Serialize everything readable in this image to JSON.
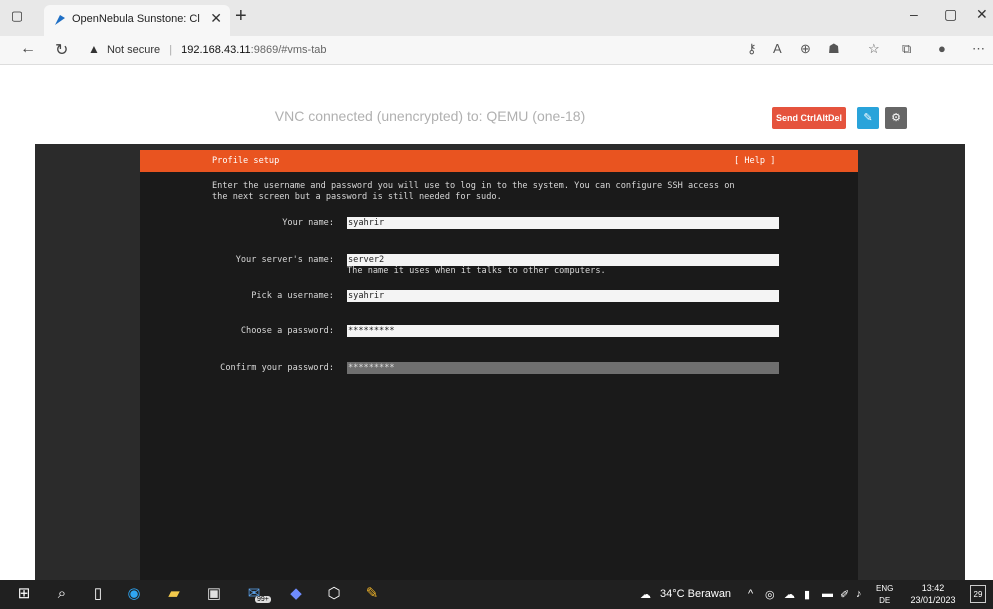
{
  "browser": {
    "tab_title": "OpenNebula Sunstone: Cloud O",
    "security_label": "Not secure",
    "url_host": "192.168.43.11",
    "url_rest": ":9869/#vms-tab"
  },
  "vnc": {
    "status": "VNC connected (unencrypted) to: QEMU (one-18)",
    "send_keys_label": "Send CtrlAltDel"
  },
  "console": {
    "header_title": "Profile setup",
    "help_label": "[ Help ]",
    "intro_line1": "Enter the username and password you will use to log in to the system. You can configure SSH access on",
    "intro_line2": "the next screen but a password is still needed for sudo.",
    "fields": [
      {
        "label": "Your name:",
        "value": "syahrir"
      },
      {
        "label": "Your server's name:",
        "value": "server2"
      },
      {
        "label": "Pick a username:",
        "value": "syahrir"
      },
      {
        "label": "Choose a password:",
        "value": "*********"
      },
      {
        "label": "Confirm your password:",
        "value": "*********"
      }
    ],
    "server_name_hint": "The name it uses when it talks to other computers."
  },
  "taskbar": {
    "badge": "99+",
    "weather": "34°C  Berawan",
    "lang_top": "ENG",
    "lang_bottom": "DE",
    "time": "13:42",
    "date": "23/01/2023",
    "notification_count": "29"
  },
  "colors": {
    "accent_orange": "#e95420",
    "send_button": "#e5533d",
    "edit_button": "#29a3da",
    "settings_button": "#666666"
  }
}
